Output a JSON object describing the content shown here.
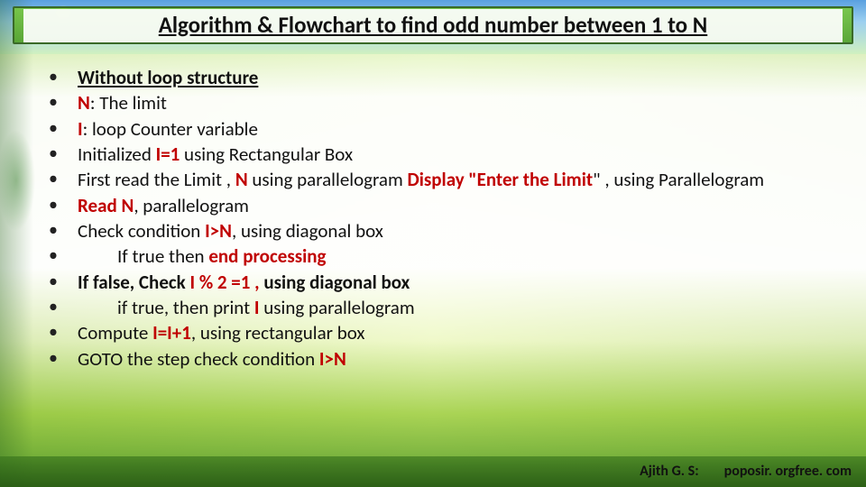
{
  "title": "Algorithm & Flowchart to find odd number between 1 to N",
  "bullets": {
    "b0": {
      "heading": "Without loop structure"
    },
    "b1": {
      "pre": "N",
      "post": ": The limit"
    },
    "b2": {
      "pre": "I",
      "post": ": loop Counter variable"
    },
    "b3": {
      "pre": "Initialized ",
      "mid": "I=1",
      "post": " using Rectangular Box"
    },
    "b4": {
      "pre": "First read the Limit , ",
      "n": "N",
      "mid": " using parallelogram ",
      "disp": "Display \"Enter the Limit",
      "q": "\" , using Parallelogram"
    },
    "b5": {
      "pre": "Read N",
      "post": ", parallelogram"
    },
    "b6": {
      "pre": "Check condition ",
      "mid": "I>N",
      "post": ", using diagonal box"
    },
    "b7": {
      "pre": "If true  then ",
      "mid": "end processing"
    },
    "b8": {
      "pre": "If false, Check ",
      "mid": "I % 2 =1 , ",
      "post": "using diagonal box"
    },
    "b9": {
      "pre": "if true, then print ",
      "mid": "I",
      "post": " using parallelogram"
    },
    "b10": {
      "pre": "Compute ",
      "mid": "I=I+1",
      "post": ", using rectangular box"
    },
    "b11": {
      "pre": "GOTO the step check condition ",
      "mid": "I>N"
    }
  },
  "footer": {
    "author": "Ajith G. S:",
    "site": "poposir. orgfree. com"
  }
}
